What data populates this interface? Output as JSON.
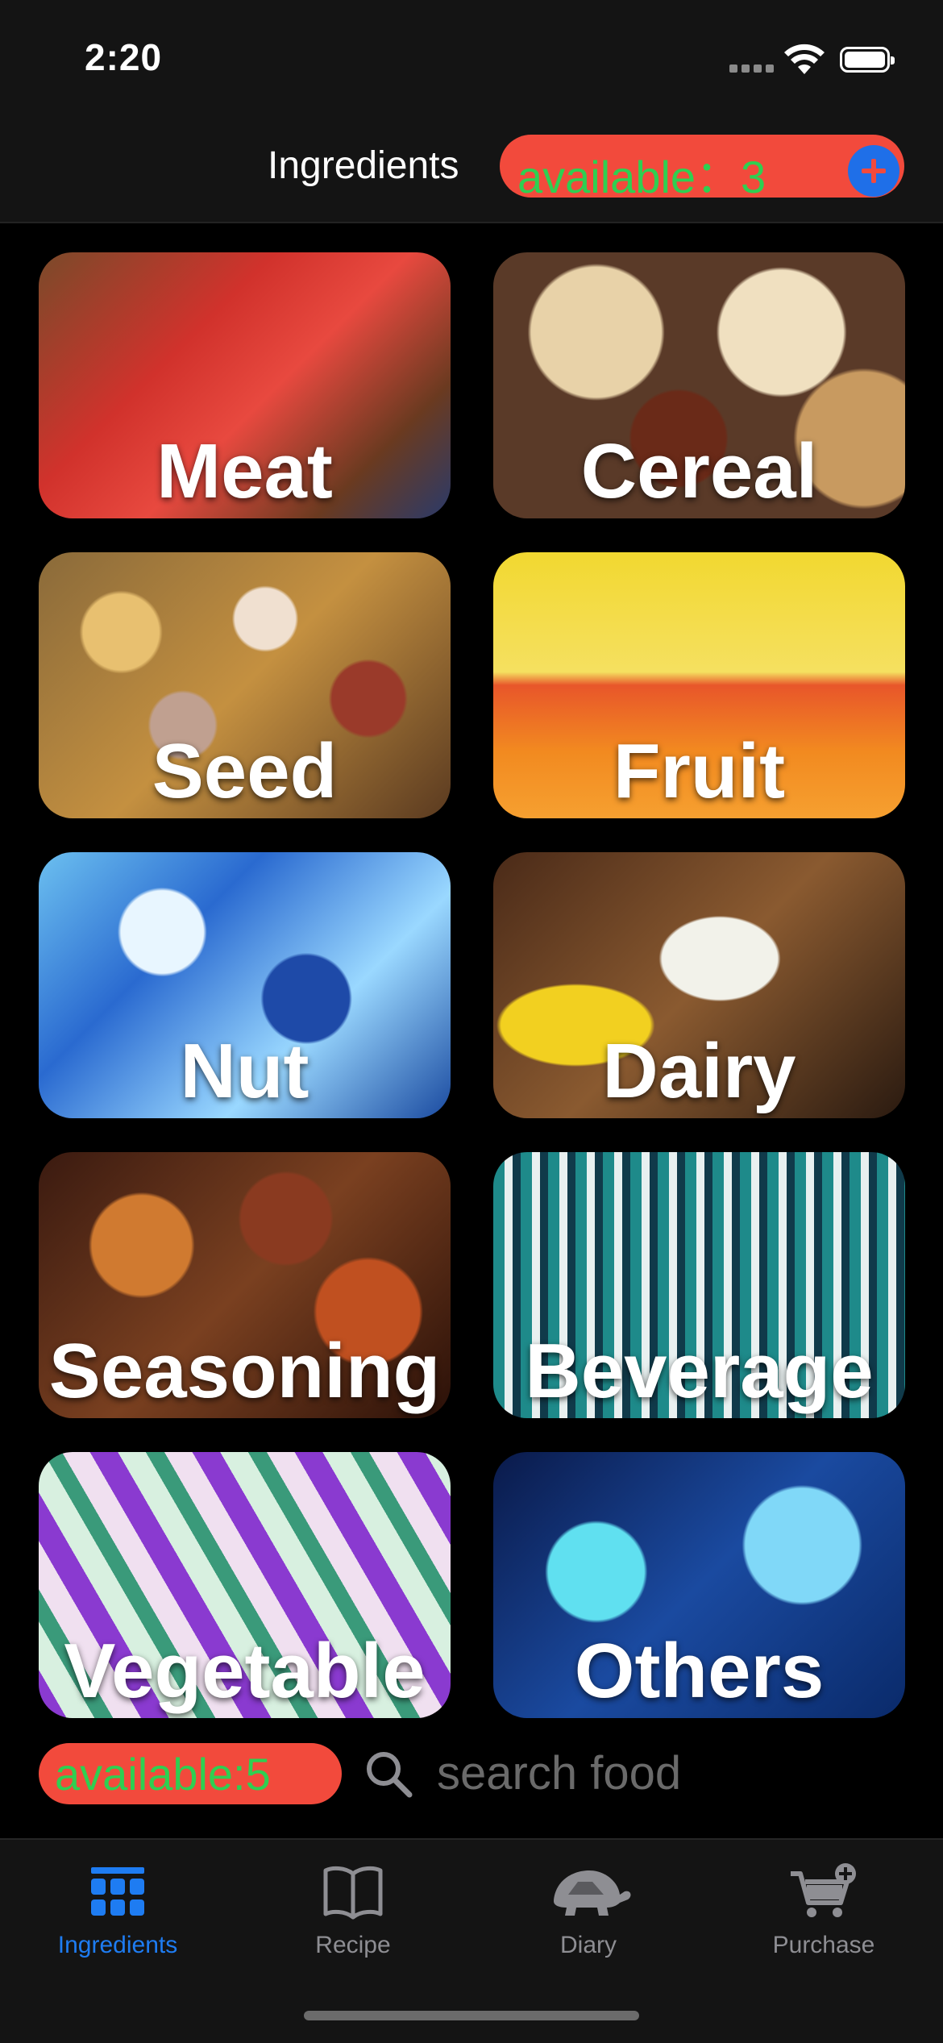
{
  "status_bar": {
    "time": "2:20"
  },
  "header": {
    "title": "Ingredients",
    "available_text": "available：3",
    "add_icon": "plus-circle-icon"
  },
  "categories": [
    {
      "label": "Meat",
      "icon": "meat-photo"
    },
    {
      "label": "Cereal",
      "icon": "cereal-photo"
    },
    {
      "label": "Seed",
      "icon": "seed-photo"
    },
    {
      "label": "Fruit",
      "icon": "fruit-photo"
    },
    {
      "label": "Nut",
      "icon": "nut-photo"
    },
    {
      "label": "Dairy",
      "icon": "dairy-photo"
    },
    {
      "label": "Seasoning",
      "icon": "seasoning-photo"
    },
    {
      "label": "Beverage",
      "icon": "beverage-photo"
    },
    {
      "label": "Vegetable",
      "icon": "vegetable-photo"
    },
    {
      "label": "Others",
      "icon": "others-photo"
    }
  ],
  "search": {
    "available_text": "available:5",
    "placeholder": "search food",
    "value": ""
  },
  "tabs": [
    {
      "label": "Ingredients",
      "icon": "grid-icon",
      "active": true
    },
    {
      "label": "Recipe",
      "icon": "book-icon",
      "active": false
    },
    {
      "label": "Diary",
      "icon": "turtle-icon",
      "active": false
    },
    {
      "label": "Purchase",
      "icon": "cart-plus-icon",
      "active": false
    }
  ],
  "colors": {
    "accent_red": "#f24a3c",
    "available_green": "#2fcf51",
    "active_blue": "#1e7cf2",
    "inactive_gray": "#8e8e93"
  }
}
